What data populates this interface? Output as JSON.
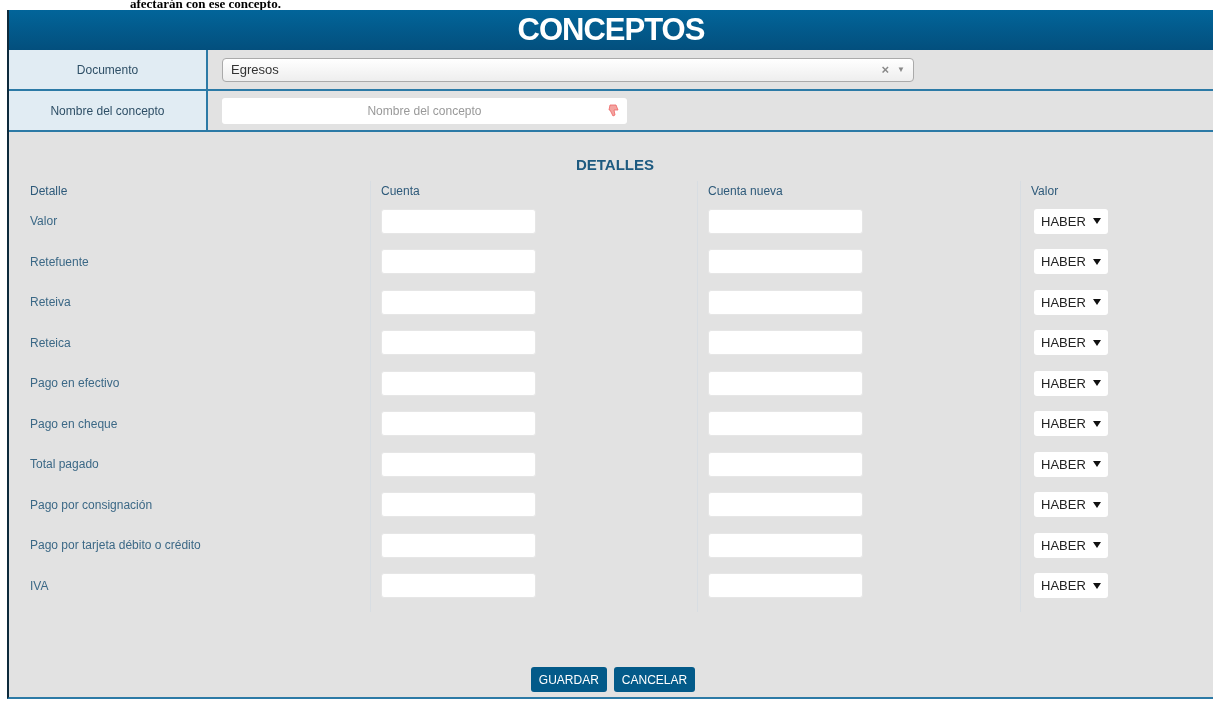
{
  "intro_text": "afectarán con ese concepto.",
  "title": "CONCEPTOS",
  "form": [
    {
      "kind": "select",
      "label": "Documento",
      "value": "Egresos",
      "clear": "×",
      "arrow": "▼"
    },
    {
      "kind": "text",
      "label": "Nombre del concepto",
      "placeholder": "Nombre del concepto",
      "invalid": true
    }
  ],
  "details": {
    "title": "DETALLES",
    "columns": [
      "Detalle",
      "Cuenta",
      "Cuenta nueva",
      "Valor"
    ],
    "rows": [
      {
        "label": "Valor",
        "side": "HABER"
      },
      {
        "label": "Retefuente",
        "side": "HABER"
      },
      {
        "label": "Reteiva",
        "side": "HABER"
      },
      {
        "label": "Reteica",
        "side": "HABER"
      },
      {
        "label": "Pago en efectivo",
        "side": "HABER"
      },
      {
        "label": "Pago en cheque",
        "side": "HABER"
      },
      {
        "label": "Total pagado",
        "side": "HABER"
      },
      {
        "label": "Pago por consignación",
        "side": "HABER"
      },
      {
        "label": "Pago por tarjeta débito o crédito",
        "side": "HABER"
      },
      {
        "label": "IVA",
        "side": "HABER"
      }
    ]
  },
  "buttons": [
    "GUARDAR",
    "CANCELAR"
  ]
}
